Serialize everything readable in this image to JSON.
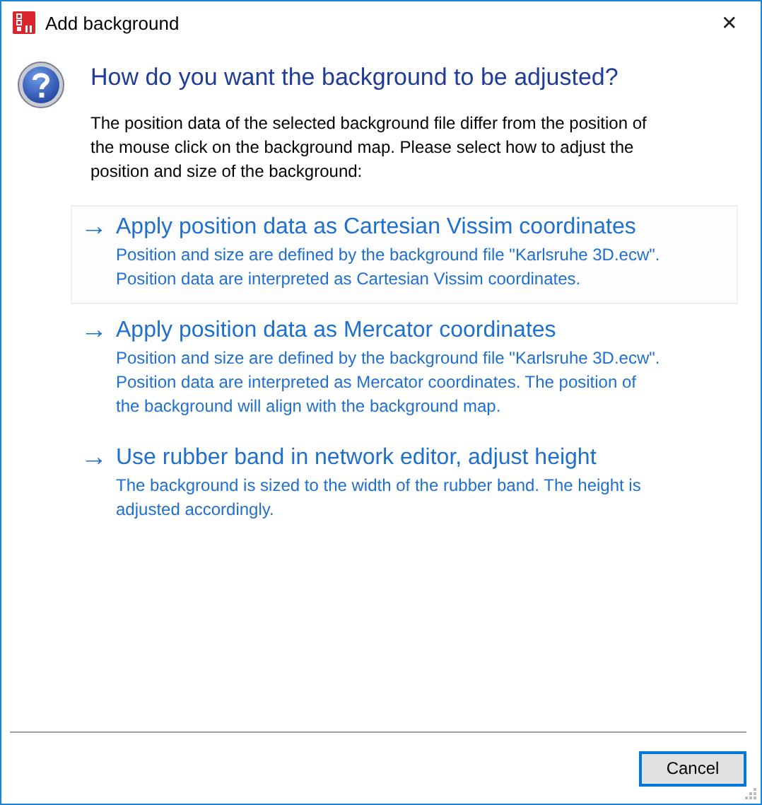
{
  "window": {
    "title": "Add background",
    "close": "✕"
  },
  "heading": "How do you want the background to be adjusted?",
  "message": [
    "The position data of the selected background file differ from the position of",
    "the mouse click on the background map. Please select how to adjust the",
    "position and size of the background:"
  ],
  "options": [
    {
      "arrow": "→",
      "title": "Apply position data as Cartesian Vissim coordinates",
      "description": [
        "Position and size are defined by the background file \"Karlsruhe 3D.ecw\".",
        "Position data are interpreted as Cartesian Vissim coordinates."
      ],
      "selected": true
    },
    {
      "arrow": "→",
      "title": "Apply position data as Mercator coordinates",
      "description": [
        "Position and size are defined by the background file \"Karlsruhe 3D.ecw\".",
        "Position data are interpreted as Mercator coordinates. The position of",
        "the background will align with the background map."
      ],
      "selected": false
    },
    {
      "arrow": "→",
      "title": "Use rubber band in network editor, adjust height",
      "description": [
        "The background is sized to the width of the rubber band. The height is",
        "adjusted accordingly."
      ],
      "selected": false
    }
  ],
  "buttons": [
    {
      "label": "Cancel",
      "selected": true
    }
  ]
}
